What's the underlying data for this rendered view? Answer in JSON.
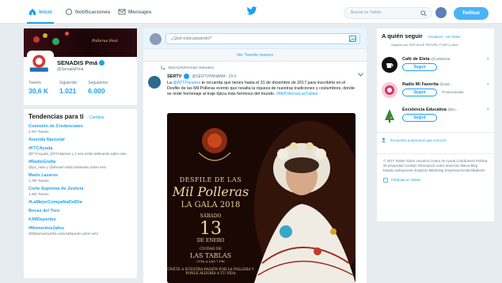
{
  "nav": {
    "items": [
      {
        "label": "Inicio",
        "icon": "home-icon",
        "active": true
      },
      {
        "label": "Notificaciones",
        "icon": "bell-icon",
        "active": false
      },
      {
        "label": "Mensajes",
        "icon": "envelope-icon",
        "active": false
      }
    ],
    "search_placeholder": "Buscar en Twitter",
    "tweet_button": "Twittear",
    "accent": "#1da1f2"
  },
  "profile": {
    "name": "SENADIS Pmá",
    "handle": "@SenadisPmá",
    "stats": [
      {
        "label": "Tweets",
        "value": "30,6 K"
      },
      {
        "label": "Siguiendo",
        "value": "1.021"
      },
      {
        "label": "Seguidores",
        "value": "6.000"
      }
    ],
    "banner_text": "Polleras Fest"
  },
  "trends": {
    "title": "Tendencias para ti",
    "change": "· Cambiar",
    "items": [
      {
        "name": "Comisión de Credenciales",
        "sub": "2.097 Tweets"
      },
      {
        "name": "Avenida Nacional",
        "sub": ""
      },
      {
        "name": "#FTCAyuda",
        "sub": "@FTCAyuda, @FTCBarrios y 2 más están twitteando sobre esto"
      },
      {
        "name": "#RadioGrafia",
        "sub": "@lpc_radio y @Ithivanl están twitteando sobre esto"
      },
      {
        "name": "Mario Lazarus",
        "sub": "1.780 Tweets"
      },
      {
        "name": "Corte Suprema de Justicia",
        "sub": "1.282 Tweets"
      },
      {
        "name": "#LaMejorCompañíaDelDía",
        "sub": ""
      },
      {
        "name": "Bocas del Toro",
        "sub": ""
      },
      {
        "name": "#JMDeportes",
        "sub": ""
      },
      {
        "name": "#MomentosJafeu",
        "sub": "@ElMomentoJafeu está twitteando sobre esto"
      }
    ]
  },
  "timeline": {
    "compose_placeholder": "¿Qué está pasando?",
    "new_tweets": "Ver Tweets nuevos",
    "tweet": {
      "context": "SENADISPANAMA Retwitteó",
      "name": "SERTV",
      "handle": "@SERTVPANAMA · 29 h",
      "text_a": "La ",
      "link_a": "@ATTPanama",
      "text_b": " te recuerda que tienes hasta el 31 de diciembre de 2017 para inscribirte en el Desfile de las Mil Polleras evento que resalta la riqueza de nuestras tradiciones y costumbres, donde se rinde homenaje al traje típica más hermoso del mundo. ",
      "link_b": "#MilPollerasLasTablas",
      "poster": {
        "desfile": "DESFILE DE LAS",
        "title": "Mil Polleras",
        "gala": "LA GALA 2018",
        "sabado": "SÁBADO",
        "day": "13",
        "month": "DE ENERO",
        "ciudad": "CIUDAD DE",
        "tablas": "LAS TABLAS",
        "cita": "CITA A LAS 7 PM",
        "small": "ÚNETE A NUESTRA PASIÓN POR LA POLLERA Y PONLE ALEGRÍA A TU VIDA"
      }
    }
  },
  "who_to_follow": {
    "title": "A quién seguir",
    "links": "· Actualizar · Ver todos",
    "meta": "Seguido por SER BLUE PATUPA, FYAR y otros",
    "suggestions": [
      {
        "name": "Café de Eleta",
        "handle": "@CafeEleta",
        "button": "Seguir",
        "extra": ""
      },
      {
        "name": "Radio Mi Favorita",
        "handle": "@radi...",
        "button": "Seguir",
        "extra": "Promocionado"
      },
      {
        "name": "Excelencia Educativa",
        "handle": "@Ex...",
        "button": "Seguir",
        "extra": ""
      }
    ],
    "find_people": "Encuentra a personas que conoces"
  },
  "footer": {
    "lines": "© 2017 Twitter  Sobre nosotros  Centro de Ayuda  Condiciones  Política de privacidad  Cookies  Información sobre anuncios  Marca  Blog  Estado  Aplicaciones  Empleos  Marketing  Empresas  Desarrolladores",
    "ad": "Publicitar en Twitter"
  }
}
